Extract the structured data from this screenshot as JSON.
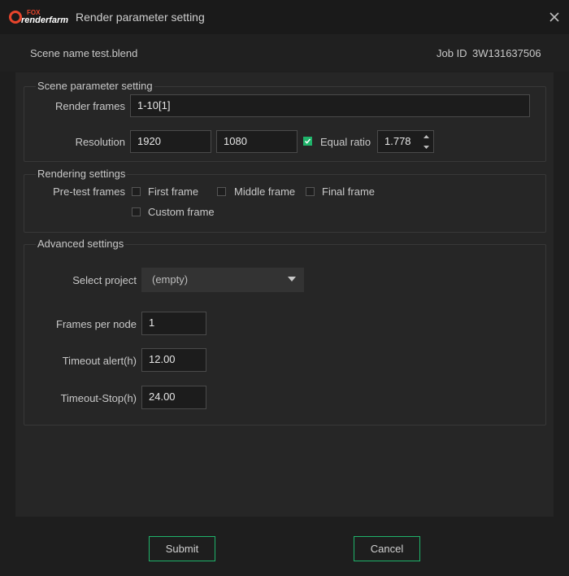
{
  "window": {
    "logo_top": "FOX",
    "logo_bottom": "renderfarm",
    "title": "Render parameter setting"
  },
  "header": {
    "scene_label": "Scene name",
    "scene_value": "test.blend",
    "job_label": "Job ID",
    "job_value": "3W131637506"
  },
  "scene_settings": {
    "title": "Scene parameter setting",
    "render_frames_label": "Render frames",
    "render_frames_value": "1-10[1]",
    "resolution_label": "Resolution",
    "width": "1920",
    "height": "1080",
    "equal_ratio_label": "Equal ratio",
    "equal_ratio_checked": true,
    "ratio_value": "1.778"
  },
  "rendering_settings": {
    "title": "Rendering settings",
    "pretest_label": "Pre-test frames",
    "first_frame": "First frame",
    "middle_frame": "Middle frame",
    "final_frame": "Final frame",
    "custom_frame": "Custom frame"
  },
  "advanced_settings": {
    "title": "Advanced settings",
    "select_project_label": "Select project",
    "select_project_value": "(empty)",
    "frames_per_node_label": "Frames per node",
    "frames_per_node_value": "1",
    "timeout_alert_label": "Timeout alert(h)",
    "timeout_alert_value": "12.00",
    "timeout_stop_label": "Timeout-Stop(h)",
    "timeout_stop_value": "24.00"
  },
  "footer": {
    "submit_label": "Submit",
    "cancel_label": "Cancel"
  },
  "colors": {
    "accent": "#1fb36a",
    "logo": "#e8452c",
    "background": "#1e1e1e"
  }
}
